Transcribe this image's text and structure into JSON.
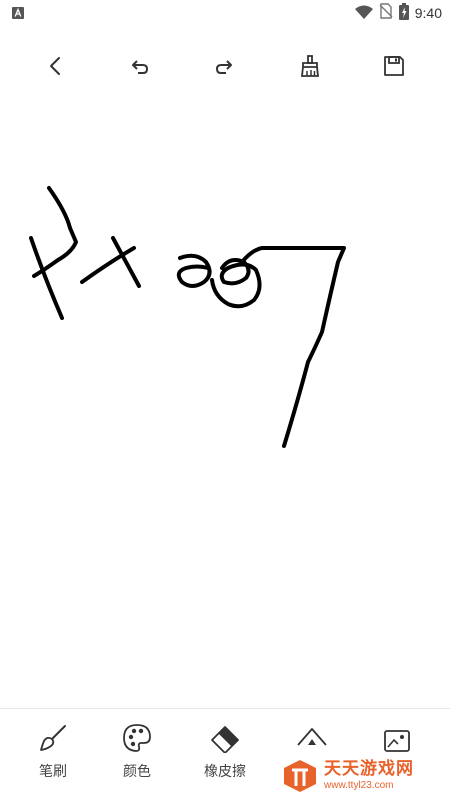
{
  "status_bar": {
    "time": "9:40",
    "icons": [
      "notification-app-icon",
      "wifi-icon",
      "no-sim-icon",
      "battery-charging-icon"
    ]
  },
  "toolbar": {
    "icons": [
      "back-icon",
      "undo-icon",
      "redo-icon",
      "clear-brush-icon",
      "save-icon"
    ]
  },
  "canvas": {
    "stroke_color": "#000000",
    "background": "#ffffff"
  },
  "bottom_bar": {
    "items": [
      {
        "label": "笔刷",
        "icon": "brush-icon"
      },
      {
        "label": "颜色",
        "icon": "palette-icon"
      },
      {
        "label": "橡皮擦",
        "icon": "eraser-icon"
      },
      {
        "label": "",
        "icon": "shape-icon"
      },
      {
        "label": "",
        "icon": "image-icon"
      }
    ]
  },
  "watermark": {
    "title": "天天游戏网",
    "subtitle": "www.ttyl23.com",
    "color": "#e8632b"
  }
}
